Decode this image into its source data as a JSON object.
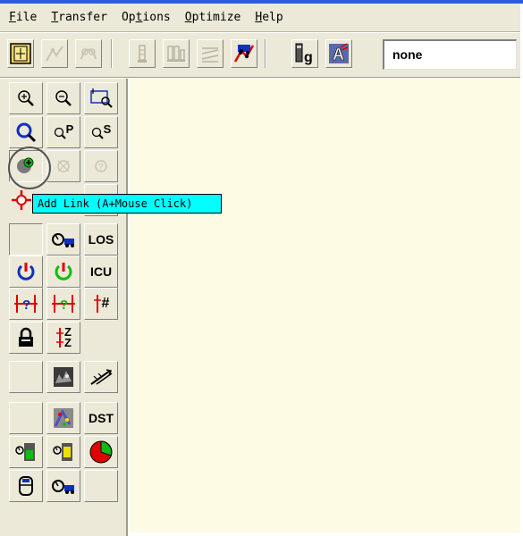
{
  "menu": {
    "file": {
      "first": "F",
      "rest": "ile"
    },
    "transfer": {
      "first": "T",
      "rest": "ransfer"
    },
    "options": {
      "pre": "Op",
      "mid": "t",
      "post": "ions"
    },
    "optimize": {
      "first": "O",
      "rest": "ptimize"
    },
    "help": {
      "first": "H",
      "rest": "elp"
    }
  },
  "toolbar": {
    "buttons": [
      "map-frame-icon",
      "link-disabled-icon",
      "route-disabled-icon",
      "tower-disabled-icon",
      "multi-tower-disabled-icon",
      "lines-disabled-icon",
      "drive-test-icon",
      "site-config-icon",
      "antenna-pattern-icon"
    ],
    "layer_value": "none"
  },
  "side_panel": {
    "los_label": "LOS",
    "icu_label": "ICU",
    "dst_label": "DST",
    "q_p": "P",
    "q_s": "S",
    "hash": "#",
    "z_top": "Z",
    "z_bottom": "Z"
  },
  "tooltip": {
    "text": "Add Link (A+Mouse Click)"
  },
  "colors": {
    "canvas": "#fdfbe3",
    "tooltip": "#00ffff",
    "panel": "#ece9d8",
    "accent_red": "#e00000",
    "accent_green": "#11bb11",
    "accent_blue": "#1030c0",
    "accent_yellow": "#f0e000"
  }
}
